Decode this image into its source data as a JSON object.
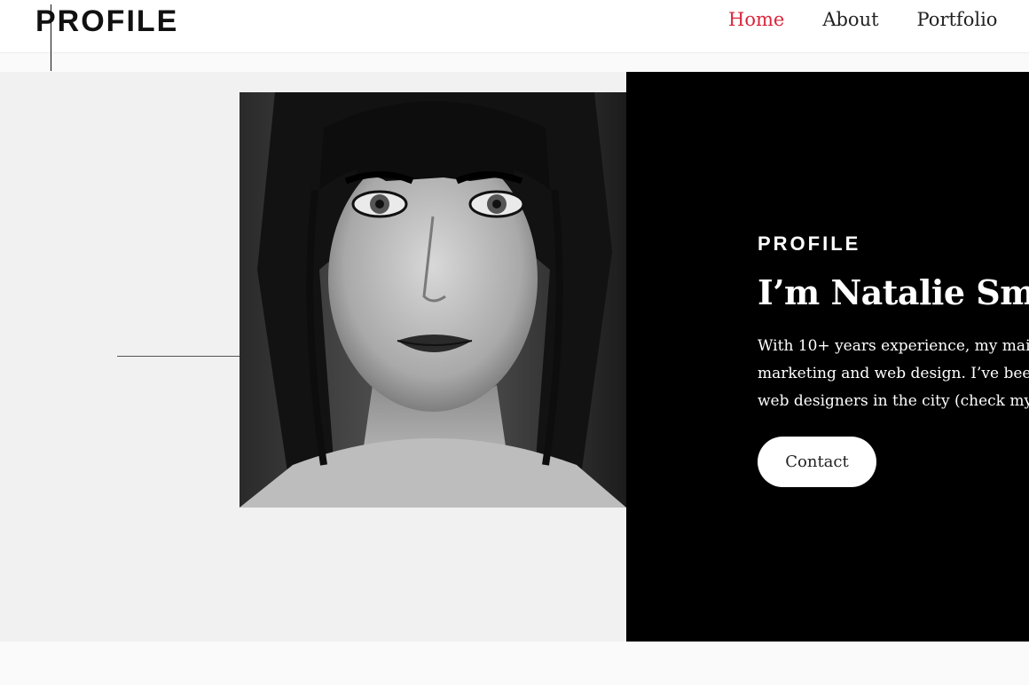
{
  "header": {
    "logo": "PROFILE",
    "nav": [
      {
        "label": "Home",
        "active": true
      },
      {
        "label": "About",
        "active": false
      },
      {
        "label": "Portfolio",
        "active": false
      }
    ]
  },
  "hero": {
    "eyebrow": "PROFILE",
    "headline": "I’m Natalie Smith",
    "bio_lines": [
      "With 10+ years experience, my mair",
      "marketing and web design. I’ve bee",
      "web designers in the city (check my"
    ],
    "contact_label": "Contact"
  },
  "colors": {
    "accent": "#d9253b",
    "dark_panel": "#000000",
    "light_panel": "#f1f1f1"
  }
}
